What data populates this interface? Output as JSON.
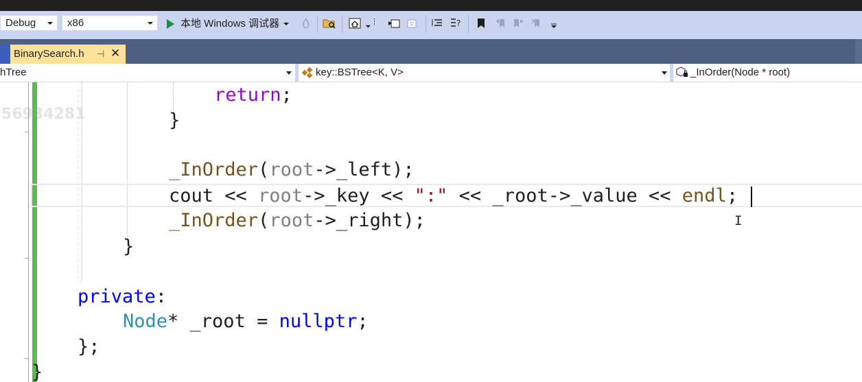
{
  "toolbar": {
    "config": "Debug",
    "platform": "x86",
    "debugger_label": "本地 Windows 调试器"
  },
  "tab": {
    "filename": "BinarySearch.h",
    "pin_glyph": "⊣",
    "close_glyph": "✕"
  },
  "navbar": {
    "project": "hTree",
    "scope": "key::BSTree<K, V>",
    "member": "_InOrder(Node * root)"
  },
  "editor": {
    "watermark": "56934281",
    "lines": {
      "l1": {
        "kw": "return",
        "rest": ";"
      },
      "l2": {
        "text": "}"
      },
      "l4": {
        "fn": "_InOrder",
        "p1": "(",
        "param": "root",
        "rest": "->_left);"
      },
      "l5": {
        "t1": "cout << ",
        "param": "root",
        "t2": "->_key << ",
        "str": "\":\"",
        "t3": " << _root->_value << ",
        "fn": "endl",
        "t4": ";"
      },
      "l6": {
        "fn": "_InOrder",
        "p1": "(",
        "param": "root",
        "rest": "->_right);"
      },
      "l7": {
        "text": "}"
      },
      "l9": {
        "kw": "private",
        "rest": ":"
      },
      "l10": {
        "type": "Node",
        "t1": "* _root = ",
        "kw": "nullptr",
        "rest": ";"
      },
      "l11": {
        "text": "};"
      },
      "l12": {
        "text": "}"
      }
    }
  },
  "colors": {
    "keyword": "#0000ff",
    "control_keyword": "#8f08c4",
    "parameter": "#808080",
    "function": "#74531f",
    "type": "#2b91af",
    "string": "#a31515",
    "change_bar": "#5cbb4e",
    "tab_active": "#fde29a",
    "toolbar_bg": "#ccd5f0"
  }
}
